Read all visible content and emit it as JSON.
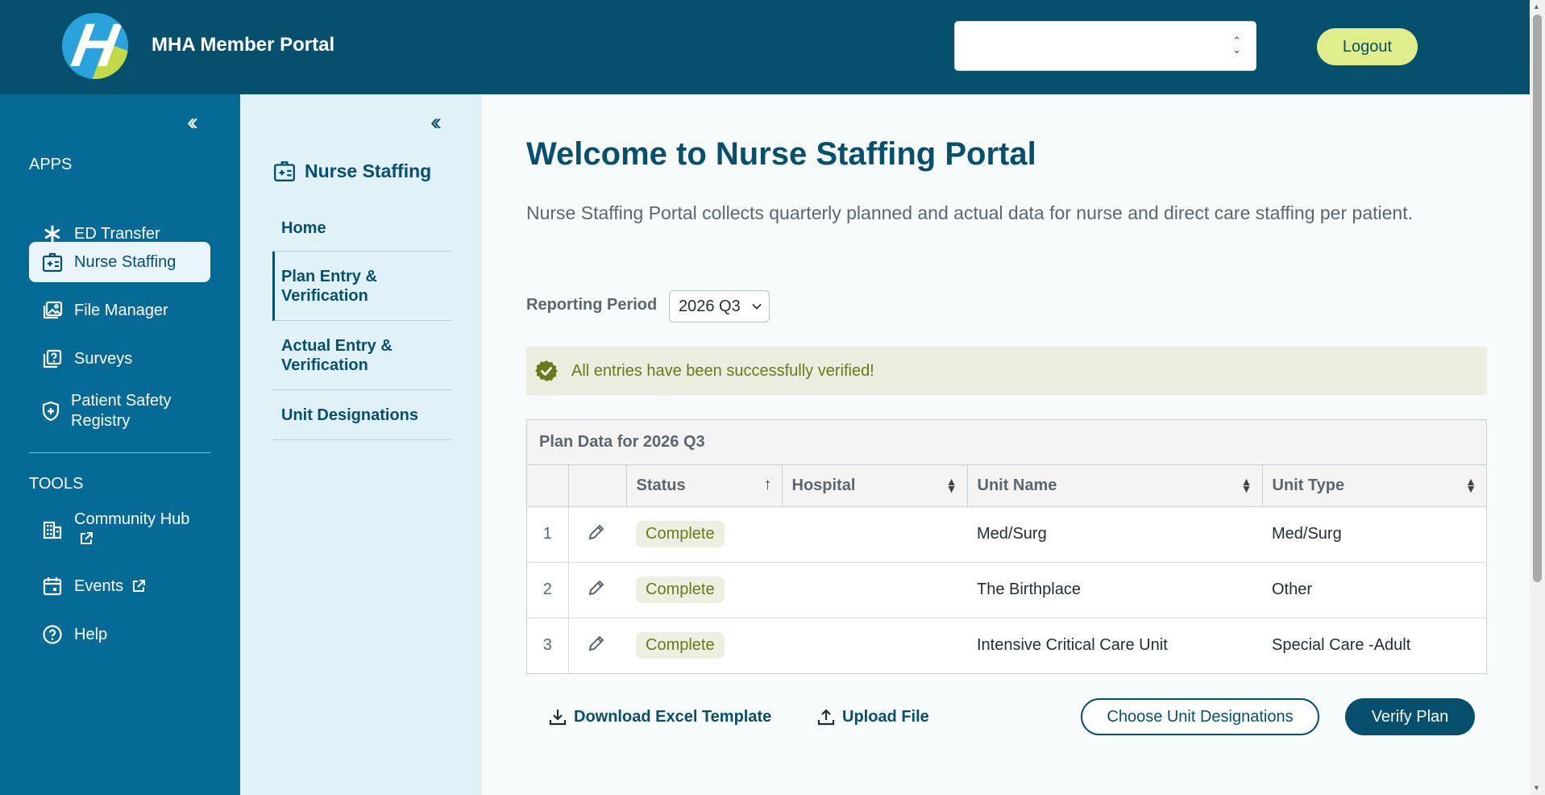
{
  "header": {
    "app_title": "MHA Member Portal",
    "org_select_value": "",
    "logout_label": "Logout"
  },
  "sidebar": {
    "collapse_icon": "double-chevron-left-icon",
    "apps_heading": "APPS",
    "apps": [
      {
        "label": "ED Transfer",
        "icon": "asterisk-icon"
      },
      {
        "label": "Nurse Staffing",
        "icon": "badge-icon",
        "active": true
      },
      {
        "label": "File Manager",
        "icon": "images-icon"
      },
      {
        "label": "Surveys",
        "icon": "question-square-icon"
      },
      {
        "label": "Patient Safety Registry",
        "icon": "shield-plus-icon"
      }
    ],
    "tools_heading": "TOOLS",
    "tools": [
      {
        "label": "Community Hub",
        "icon": "building-icon",
        "external": true
      },
      {
        "label": "Events",
        "icon": "calendar-icon",
        "external": true
      },
      {
        "label": "Help",
        "icon": "help-circle-icon"
      }
    ]
  },
  "subnav": {
    "title": "Nurse Staffing",
    "items": [
      {
        "label": "Home"
      },
      {
        "label": "Plan Entry & Verification",
        "active": true
      },
      {
        "label": "Actual Entry & Verification"
      },
      {
        "label": "Unit Designations"
      }
    ]
  },
  "main": {
    "title": "Welcome to Nurse Staffing Portal",
    "description": "Nurse Staffing Portal collects quarterly planned and actual data for nurse and direct care staffing per patient.",
    "reporting_period_label": "Reporting Period",
    "reporting_period_value": "2026 Q3",
    "alert_text": "All entries have been successfully verified!",
    "table": {
      "caption": "Plan Data for 2026 Q3",
      "columns": [
        "",
        "",
        "Status",
        "Hospital",
        "Unit Name",
        "Unit Type"
      ],
      "rows": [
        {
          "num": "1",
          "status": "Complete",
          "hospital": "",
          "unit_name": "Med/Surg",
          "unit_type": "Med/Surg"
        },
        {
          "num": "2",
          "status": "Complete",
          "hospital": "",
          "unit_name": "The Birthplace",
          "unit_type": "Other"
        },
        {
          "num": "3",
          "status": "Complete",
          "hospital": "",
          "unit_name": "Intensive Critical Care Unit",
          "unit_type": "Special Care -Adult"
        }
      ]
    },
    "actions": {
      "download_label": "Download Excel Template",
      "upload_label": "Upload File",
      "choose_label": "Choose Unit Designations",
      "verify_label": "Verify Plan"
    }
  },
  "colors": {
    "header_bg": "#06506e",
    "sidebar_bg": "#066a97",
    "subnav_bg": "#e1f1f8",
    "accent_button": "#dfed8a",
    "success_text": "#687a1c"
  }
}
